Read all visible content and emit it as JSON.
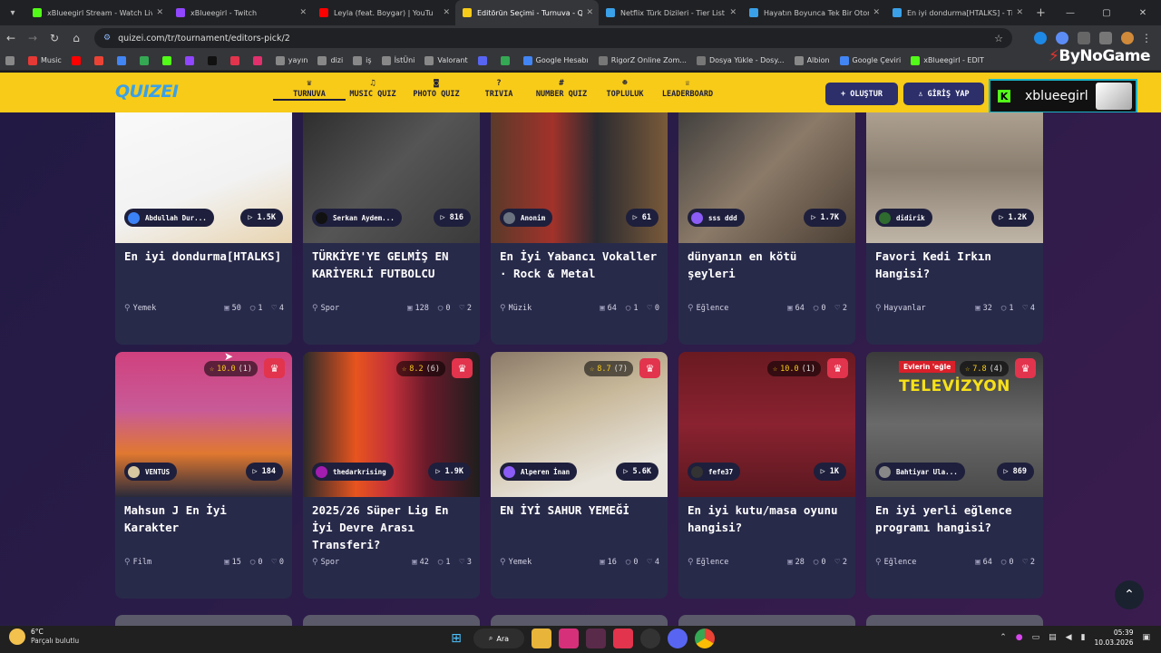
{
  "browser": {
    "tabs": [
      {
        "title": "xBlueegirl Stream - Watch Live",
        "color": "#53fc18"
      },
      {
        "title": "xBlueegirl - Twitch",
        "color": "#9146ff"
      },
      {
        "title": "Leyla (feat. Boygar) | YouTu",
        "color": "#ff0000"
      },
      {
        "title": "Editörün Seçimi - Turnuva - Qu",
        "color": "#f7cb18",
        "active": true
      },
      {
        "title": "Netflix Türk Dizileri - Tier List |",
        "color": "#3aa0e8"
      },
      {
        "title": "Hayatın Boyunca Tek Bir Otom",
        "color": "#3aa0e8"
      },
      {
        "title": "En iyi dondurma[HTALKS] - Tie",
        "color": "#3aa0e8"
      }
    ],
    "url": "quizei.com/tr/tournament/editors-pick/2",
    "bookmarks": [
      {
        "label": "Music",
        "color": "#e53935"
      },
      {
        "label": "",
        "color": "#ff0000"
      },
      {
        "label": "",
        "color": "#ea4335"
      },
      {
        "label": "",
        "color": "#4285f4"
      },
      {
        "label": "",
        "color": "#34a853"
      },
      {
        "label": "",
        "color": "#53fc18"
      },
      {
        "label": "",
        "color": "#9146ff"
      },
      {
        "label": "",
        "color": "#111111"
      },
      {
        "label": "",
        "color": "#e2344d"
      },
      {
        "label": "",
        "color": "#e1306c"
      },
      {
        "label": "yayın",
        "color": "#888888"
      },
      {
        "label": "dizi",
        "color": "#888888"
      },
      {
        "label": "iş",
        "color": "#888888"
      },
      {
        "label": "İstÜni",
        "color": "#888888"
      },
      {
        "label": "Valorant",
        "color": "#888888"
      },
      {
        "label": "",
        "color": "#5865f2"
      },
      {
        "label": "",
        "color": "#34a853"
      },
      {
        "label": "Google Hesabı",
        "color": "#4285f4"
      },
      {
        "label": "RigorZ Online Zom...",
        "color": "#777777"
      },
      {
        "label": "Dosya Yükle - Dosy...",
        "color": "#777777"
      },
      {
        "label": "Albion",
        "color": "#888888"
      },
      {
        "label": "Google Çeviri",
        "color": "#4285f4"
      },
      {
        "label": "xBlueegirl - EDIT",
        "color": "#53fc18"
      }
    ],
    "bynogame": "ByNoGame"
  },
  "site": {
    "logo": "QUIZEI",
    "nav": [
      {
        "label": "TURNUVA",
        "icon": "trophy-icon",
        "glyph": "♛",
        "active": true
      },
      {
        "label": "MUSIC QUIZ",
        "icon": "music-icon",
        "glyph": "♫"
      },
      {
        "label": "PHOTO QUIZ",
        "icon": "camera-icon",
        "glyph": "◙"
      },
      {
        "label": "TRIVIA",
        "icon": "help-icon",
        "glyph": "?"
      },
      {
        "label": "NUMBER QUIZ",
        "icon": "hash-icon",
        "glyph": "#"
      },
      {
        "label": "TOPLULUK",
        "icon": "users-icon",
        "glyph": "☻"
      },
      {
        "label": "LEADERBOARD",
        "icon": "crown-icon",
        "glyph": "♕"
      }
    ],
    "create_label": "+ OLUŞTUR",
    "login_label": "GİRİŞ YAP",
    "kick_name": "xblueegirl"
  },
  "cards": [
    {
      "author": "Abdullah Dur...",
      "plays": "1.5K",
      "title": "En iyi dondurma[HTALKS]",
      "category": "Yemek",
      "items": "50",
      "comments": "1",
      "likes": "4",
      "rating": null,
      "img": "linear-gradient(160deg,#fafafa,#f2f2f2 60%,#e8d4b0)",
      "av": "#3b82f6"
    },
    {
      "author": "Serkan Aydem...",
      "plays": "816",
      "title": "TÜRKİYE'YE GELMİŞ EN KARİYERLİ FUTBOLCU",
      "category": "Spor",
      "items": "128",
      "comments": "0",
      "likes": "2",
      "rating": null,
      "img": "linear-gradient(135deg,#2a2a2a,#555 50%,#3a3a3a)",
      "av": "#111"
    },
    {
      "author": "Anonim",
      "plays": "61",
      "title": "En İyi Yabancı Vokaller · Rock & Metal",
      "category": "Müzik",
      "items": "64",
      "comments": "1",
      "likes": "0",
      "rating": null,
      "img": "linear-gradient(90deg,#5a3a2a,#a2322a 35%,#2a2a30 60%,#7a5a3a)",
      "av": "#6b7280"
    },
    {
      "author": "sss ddd",
      "plays": "1.7K",
      "title": "dünyanın en kötü şeyleri",
      "category": "Eğlence",
      "items": "64",
      "comments": "0",
      "likes": "2",
      "rating": null,
      "img": "linear-gradient(135deg,#3a3a3a,#8b7a68 50%,#4a3e34)",
      "av": "#8b5cf6"
    },
    {
      "author": "didirik",
      "plays": "1.2K",
      "title": "Favori Kedi Irkın Hangisi?",
      "category": "Hayvanlar",
      "items": "32",
      "comments": "1",
      "likes": "4",
      "rating": null,
      "img": "linear-gradient(180deg,#b5a898,#8a7e70 50%,#c0b6a8)",
      "av": "#2f6b2f"
    },
    {
      "author": "VENTUS",
      "plays": "184",
      "title": "Mahsun J En İyi Karakter",
      "category": "Film",
      "items": "15",
      "comments": "0",
      "likes": "0",
      "rating": "10.0",
      "votes": "(1)",
      "img": "linear-gradient(180deg,#d0417e,#c85a98 40%,#e07830 70%,#2a2a3a)",
      "av": "#d8c8a0"
    },
    {
      "author": "thedarkrising",
      "plays": "1.9K",
      "title": "2025/26 Süper Lig En İyi Devre Arası Transferi?",
      "category": "Spor",
      "items": "42",
      "comments": "1",
      "likes": "3",
      "rating": "8.2",
      "votes": "(6)",
      "img": "linear-gradient(90deg,#2a2a2a,#e8541e 30%,#c2303a 50%,#6a1a2a 70%,#1e1e1e)",
      "av": "#a21caf"
    },
    {
      "author": "Alperen İnan",
      "plays": "5.6K",
      "title": "EN İYİ SAHUR YEMEĞİ",
      "category": "Yemek",
      "items": "16",
      "comments": "0",
      "likes": "4",
      "rating": "8.7",
      "votes": "(7)",
      "img": "linear-gradient(160deg,#8a7a68,#c8b89a 40%,#e8e4dc 80%)",
      "av": "#8b5cf6"
    },
    {
      "author": "fefe37",
      "plays": "1K",
      "title": "En iyi kutu/masa oyunu hangisi?",
      "category": "Eğlence",
      "items": "28",
      "comments": "0",
      "likes": "2",
      "rating": "10.0",
      "votes": "(1)",
      "img": "linear-gradient(180deg,#6a1a22,#8a2230 50%,#5a1820)",
      "av": "#333"
    },
    {
      "author": "Bahtiyar Ula...",
      "plays": "869",
      "title": "En iyi yerli eğlence programı hangisi?",
      "category": "Eğlence",
      "items": "64",
      "comments": "0",
      "likes": "2",
      "rating": "7.8",
      "votes": "(4)",
      "img": "linear-gradient(180deg,#3a3a3a,#6a6a6a 50%,#4a4a4a)",
      "av": "#888",
      "banner": "TELEVİZYON",
      "tag": "Evlerin 'eğle"
    }
  ],
  "taskbar": {
    "temp": "6°C",
    "weather": "Parçalı bulutlu",
    "search": "Ara",
    "time": "05:39",
    "date": "10.03.2026"
  }
}
